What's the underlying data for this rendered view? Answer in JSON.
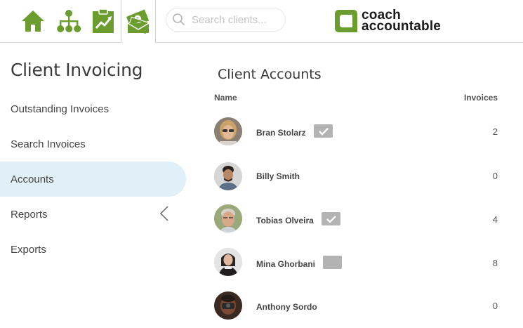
{
  "colors": {
    "brand_green": "#6a9c2e",
    "active_bg": "#e1eff9",
    "badge_gray": "#b3b3b3"
  },
  "nav": {
    "icons": [
      "home-icon",
      "org-chart-icon",
      "clipboard-chart-icon",
      "money-icon"
    ],
    "active": "money-icon"
  },
  "search": {
    "placeholder": "Search clients..."
  },
  "logo": {
    "line1": "coach",
    "line2": "accountable"
  },
  "sidebar": {
    "title": "Client Invoicing",
    "items": [
      {
        "label": "Outstanding Invoices",
        "active": false
      },
      {
        "label": "Search Invoices",
        "active": false
      },
      {
        "label": "Accounts",
        "active": true
      },
      {
        "label": "Reports",
        "active": false
      },
      {
        "label": "Exports",
        "active": false
      }
    ]
  },
  "main": {
    "title": "Client Accounts",
    "columns": {
      "name": "Name",
      "invoices": "Invoices"
    },
    "clients": [
      {
        "name": "Bran Stolarz",
        "invoices": "2",
        "badge": "checked"
      },
      {
        "name": "Billy Smith",
        "invoices": "0",
        "badge": "none"
      },
      {
        "name": "Tobias Olveira",
        "invoices": "4",
        "badge": "checked"
      },
      {
        "name": "Mina Ghorbani",
        "invoices": "8",
        "badge": "empty"
      },
      {
        "name": "Anthony Sordo",
        "invoices": "0",
        "badge": "none"
      }
    ]
  }
}
